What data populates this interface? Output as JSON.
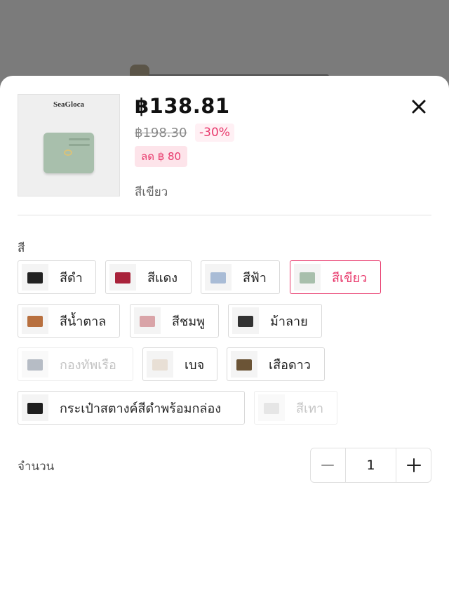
{
  "product": {
    "brand": "SeaGloca",
    "price": "฿138.81",
    "original_price": "฿198.30",
    "discount_percent": "-30%",
    "discount_amount": "ลด ฿ 80",
    "selected_variant": "สีเขียว"
  },
  "color_section": {
    "label": "สี",
    "options": [
      {
        "label": "สีดำ",
        "state": "normal",
        "swatch": "#222222"
      },
      {
        "label": "สีแดง",
        "state": "normal",
        "swatch": "#a8223a"
      },
      {
        "label": "สีฟ้า",
        "state": "normal",
        "swatch": "#a9bcd6"
      },
      {
        "label": "สีเขียว",
        "state": "selected",
        "swatch": "#a8bfac"
      },
      {
        "label": "สีน้ำตาล",
        "state": "normal",
        "swatch": "#b8703f"
      },
      {
        "label": "สีชมพู",
        "state": "normal",
        "swatch": "#d9a4a8"
      },
      {
        "label": "ม้าลาย",
        "state": "normal",
        "swatch": "#333333"
      },
      {
        "label": "กองทัพเรือ",
        "state": "disabled",
        "swatch": "#6f7b8c"
      },
      {
        "label": "เบจ",
        "state": "normal",
        "swatch": "#e8dfd5"
      },
      {
        "label": "เสือดาว",
        "state": "normal",
        "swatch": "#6b5436"
      },
      {
        "label": "กระเป๋าสตางค์สีดำพร้อมกล่อง",
        "state": "normal",
        "swatch": "#1e1e1e"
      },
      {
        "label": "สีเทา",
        "state": "disabled",
        "swatch": "#cfcfcf"
      }
    ]
  },
  "quantity": {
    "label": "จำนวน",
    "value": "1"
  },
  "colors": {
    "accent": "#e8386b",
    "accent_bg": "#fde4ea",
    "overlay": "#7c7c7c"
  },
  "icons": {
    "close": "close-icon",
    "minus": "minus-icon",
    "plus": "plus-icon"
  }
}
